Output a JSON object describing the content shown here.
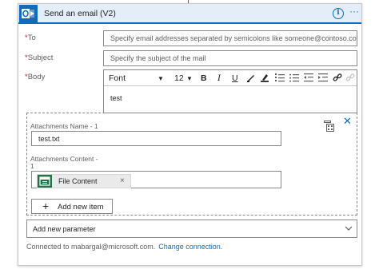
{
  "header": {
    "title": "Send an email (V2)",
    "accent_color": "#0f6cbd",
    "info_icon": "i",
    "more_icon": "···"
  },
  "fields": {
    "to": {
      "required_mark": "*",
      "label": "To",
      "placeholder": "Specify email addresses separated by semicolons like someone@contoso.com"
    },
    "subject": {
      "required_mark": "*",
      "label": "Subject",
      "placeholder": "Specify the subject of the mail"
    },
    "body": {
      "required_mark": "*",
      "label": "Body",
      "value": "test"
    }
  },
  "toolbar": {
    "font": "Font",
    "font_size": "12",
    "bold": "B",
    "italic": "I",
    "underline": "U"
  },
  "attachments": {
    "name_label": "Attachments Name - 1",
    "name_value": "test.txt",
    "content_label_line1": "Attachments Content -",
    "content_label_line2": "1",
    "content_chip_label": "File Content",
    "content_chip_remove": "×",
    "add_item_label": "Add new item",
    "add_item_icon": "+",
    "remove_icon": "✕",
    "chip_color": "#217346"
  },
  "add_parameter": {
    "label": "Add new parameter"
  },
  "footer": {
    "connected_text": "Connected to mabargal@microsoft.com.",
    "change_link": "Change connection."
  }
}
